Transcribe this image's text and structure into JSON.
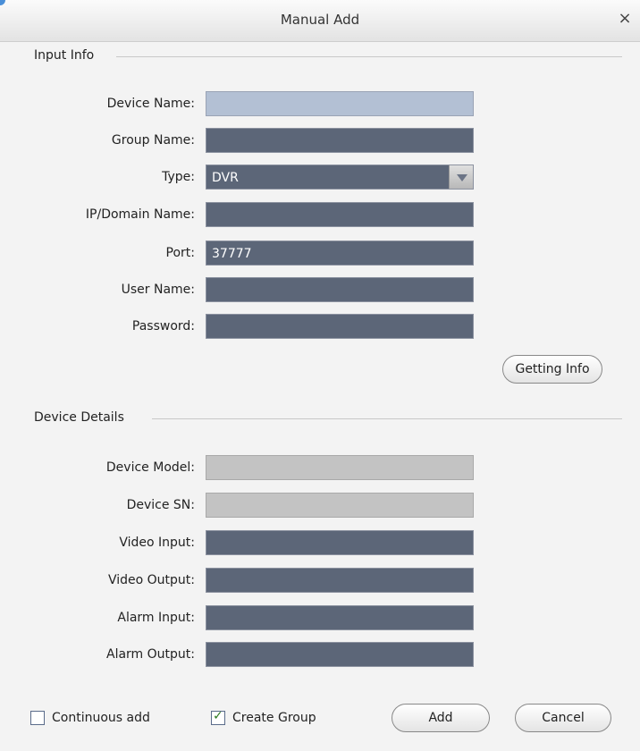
{
  "window": {
    "title": "Manual Add",
    "close_symbol": "×"
  },
  "input_info": {
    "section_title": "Input Info",
    "fields": {
      "device_name": {
        "label": "Device Name:",
        "value": ""
      },
      "group_name": {
        "label": "Group Name:",
        "value": ""
      },
      "type": {
        "label": "Type:",
        "value": "DVR"
      },
      "ip_domain": {
        "label": "IP/Domain Name:",
        "value": ""
      },
      "port": {
        "label": "Port:",
        "value": "37777"
      },
      "user_name": {
        "label": "User Name:",
        "value": ""
      },
      "password": {
        "label": "Password:",
        "value": ""
      }
    },
    "getting_info_label": "Getting Info"
  },
  "device_details": {
    "section_title": "Device Details",
    "fields": {
      "device_model": {
        "label": "Device Model:",
        "value": ""
      },
      "device_sn": {
        "label": "Device SN:",
        "value": ""
      },
      "video_input": {
        "label": "Video Input:",
        "value": ""
      },
      "video_output": {
        "label": "Video Output:",
        "value": ""
      },
      "alarm_input": {
        "label": "Alarm Input:",
        "value": ""
      },
      "alarm_output": {
        "label": "Alarm Output:",
        "value": ""
      }
    }
  },
  "footer": {
    "continuous_add": {
      "label": "Continuous add",
      "checked": false
    },
    "create_group": {
      "label": "Create Group",
      "checked": true,
      "mark": "✓"
    },
    "add_label": "Add",
    "cancel_label": "Cancel"
  }
}
